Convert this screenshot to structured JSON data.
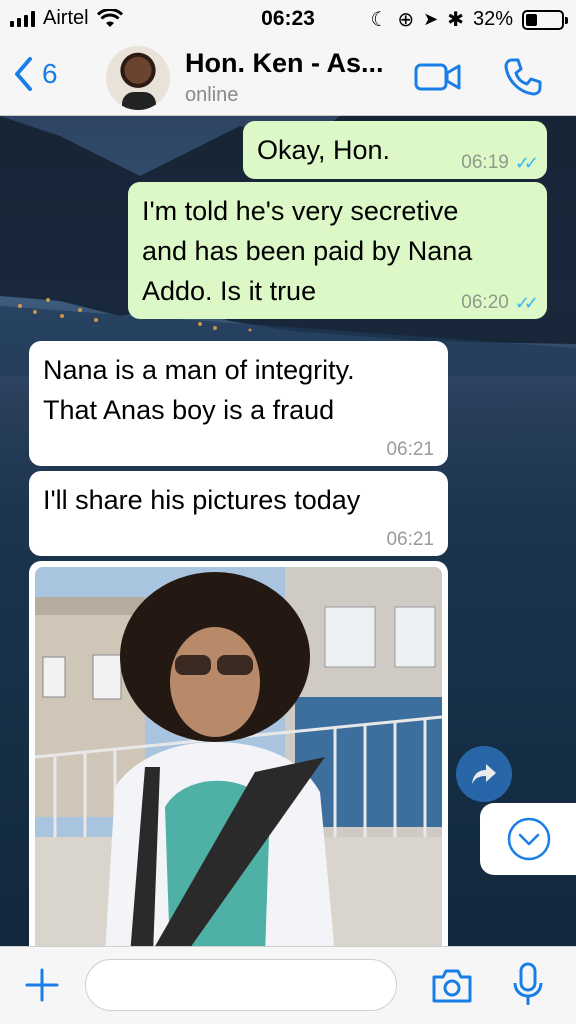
{
  "status_bar": {
    "carrier": "Airtel",
    "time": "06:23",
    "battery": "32%",
    "battery_level": 0.32
  },
  "header": {
    "back_count": "6",
    "contact_name": "Hon. Ken - As...",
    "contact_status": "online"
  },
  "messages": [
    {
      "direction": "out",
      "text": "Okay, Hon.",
      "time": "06:19",
      "status": "read"
    },
    {
      "direction": "out",
      "text": "I'm told he's very secretive\nand has been paid by Nana\nAddo. Is it true",
      "time": "06:20",
      "status": "read"
    },
    {
      "direction": "in",
      "text": "Nana is a man of integrity.\nThat Anas boy is a fraud",
      "time": "06:21"
    },
    {
      "direction": "in",
      "text": "I'll share his pictures today",
      "time": "06:21"
    }
  ],
  "icons": {
    "back": "chevron-left-icon",
    "video": "video-camera-icon",
    "call": "phone-icon",
    "forward": "forward-arrow-icon",
    "scroll": "chevron-down-circle-icon",
    "plus": "plus-icon",
    "camera": "camera-icon",
    "mic": "microphone-icon"
  },
  "colors": {
    "accent": "#1a7ee8",
    "outgoing_bubble": "#dcf8c6",
    "incoming_bubble": "#ffffff",
    "read_ticks": "#34b7f1"
  },
  "composer": {
    "value": "",
    "placeholder": ""
  }
}
